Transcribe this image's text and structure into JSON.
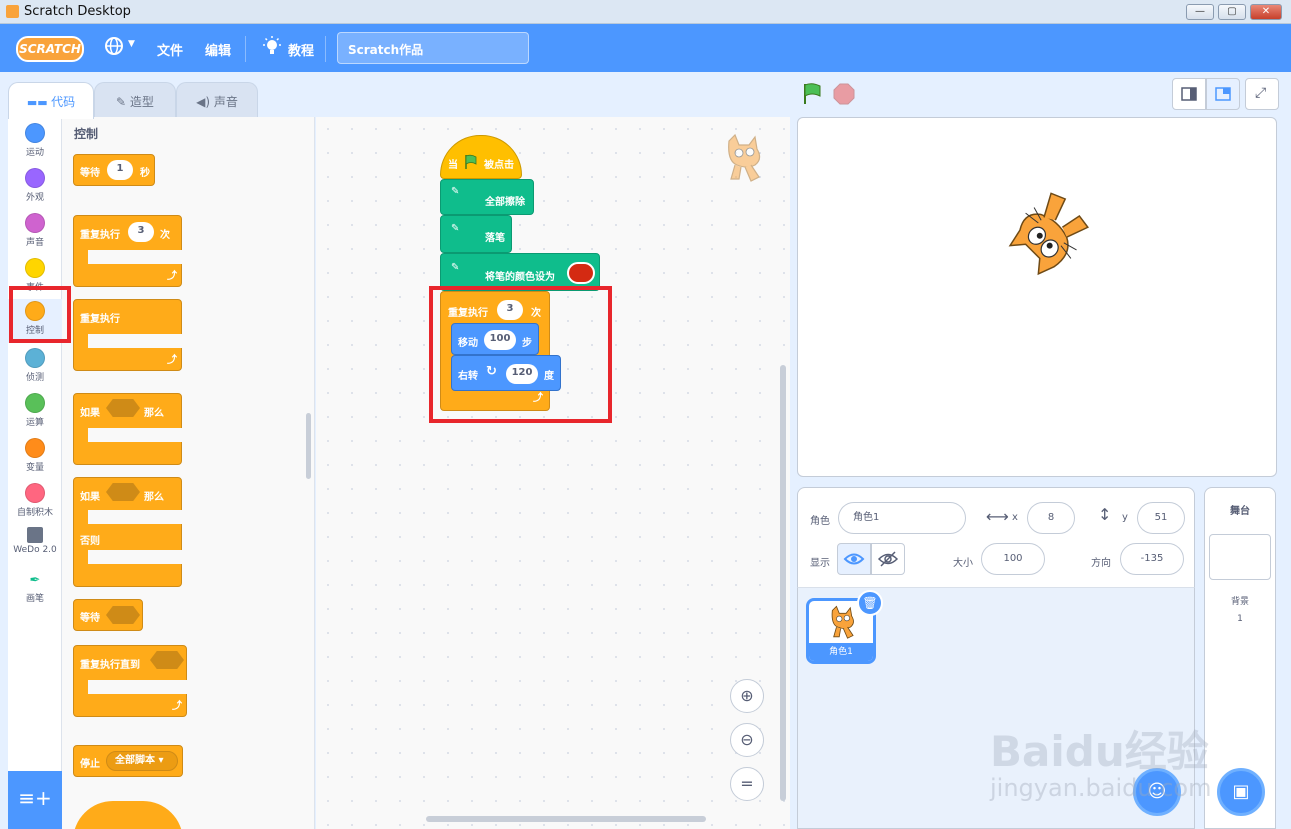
{
  "window": {
    "title": "Scratch Desktop",
    "min": "—",
    "max": "▢",
    "close": "✕"
  },
  "menubar": {
    "logo": "SCRATCH",
    "file": "文件",
    "edit": "编辑",
    "tutorials": "教程",
    "project_title": "Scratch作品",
    "accent": "#4c97ff"
  },
  "tabs": {
    "code": "代码",
    "costumes": "造型",
    "sounds": "声音"
  },
  "categories": [
    {
      "label": "运动",
      "color": "#4c97ff"
    },
    {
      "label": "外观",
      "color": "#9966ff"
    },
    {
      "label": "声音",
      "color": "#cf63cf"
    },
    {
      "label": "事件",
      "color": "#ffd500"
    },
    {
      "label": "控制",
      "color": "#ffab19"
    },
    {
      "label": "侦测",
      "color": "#5cb1d6"
    },
    {
      "label": "运算",
      "color": "#59c059"
    },
    {
      "label": "变量",
      "color": "#ff8c1a"
    },
    {
      "label": "自制积木",
      "color": "#ff6680"
    },
    {
      "label": "WeDo 2.0",
      "color": ""
    },
    {
      "label": "画笔",
      "color": ""
    }
  ],
  "palette": {
    "heading": "控制",
    "wait": {
      "pre": "等待",
      "value": "1",
      "post": "秒"
    },
    "repeat": {
      "pre": "重复执行",
      "value": "3",
      "post": "次"
    },
    "forever": "重复执行",
    "if_then": {
      "pre": "如果",
      "post": "那么"
    },
    "if_else": {
      "pre": "如果",
      "post": "那么",
      "else": "否则"
    },
    "wait_until": "等待",
    "repeat_until": "重复执行直到",
    "stop": {
      "pre": "停止",
      "option": "全部脚本"
    }
  },
  "script": {
    "hat": {
      "pre": "当",
      "post": "被点击"
    },
    "clear": "全部擦除",
    "pen_down": "落笔",
    "set_color": "将笔的颜色设为",
    "pen_color": "#d42a12",
    "repeat": {
      "pre": "重复执行",
      "value": "3",
      "post": "次"
    },
    "move": {
      "pre": "移动",
      "value": "100",
      "post": "步"
    },
    "turn": {
      "pre": "右转",
      "value": "120",
      "post": "度"
    }
  },
  "sprite_info": {
    "sprite_label": "角色",
    "sprite_name": "角色1",
    "x_label": "x",
    "x": "8",
    "y_label": "y",
    "y": "51",
    "show_label": "显示",
    "size_label": "大小",
    "size": "100",
    "direction_label": "方向",
    "direction": "-135"
  },
  "sprites": [
    {
      "name": "角色1"
    }
  ],
  "stage_panel": {
    "title": "舞台",
    "backdrops_label": "背景",
    "backdrops_count": "1"
  },
  "watermark": {
    "line1": "Baidu经验",
    "line2": "jingyan.baidu.com"
  }
}
